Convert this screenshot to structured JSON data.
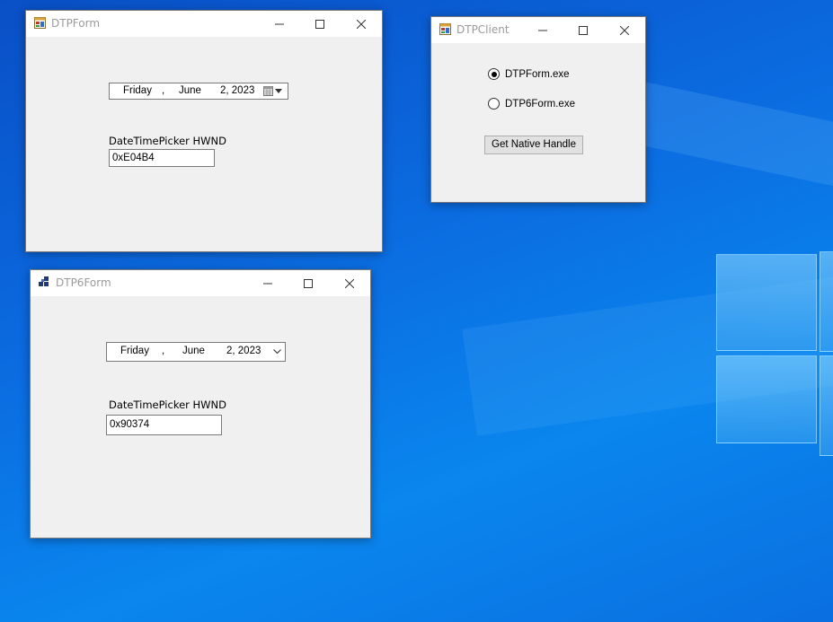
{
  "dtpform": {
    "title": "DTPForm",
    "dtp": {
      "day": "Friday",
      "comma": ",",
      "month": "June",
      "date": "2, 2023"
    },
    "hwnd_label": "DateTimePicker HWND",
    "hwnd_value": "0xE04B4"
  },
  "dtpclient": {
    "title": "DTPClient",
    "options": [
      {
        "label": "DTPForm.exe",
        "checked": true
      },
      {
        "label": "DTP6Form.exe",
        "checked": false
      }
    ],
    "button_label": "Get Native Handle"
  },
  "dtp6form": {
    "title": "DTP6Form",
    "dtp": {
      "day": "Friday",
      "comma": ",",
      "month": "June",
      "date": "2, 2023"
    },
    "hwnd_label": "DateTimePicker HWND",
    "hwnd_value": "0x90374"
  },
  "colors": {
    "desktop": "#0b6be0",
    "window_bg": "#f0f0f0",
    "title_text_inactive": "#9a9a9a"
  },
  "icons": [
    "form-icon",
    "minimize-icon",
    "maximize-icon",
    "close-icon",
    "calendar-dropdown-icon",
    "chevron-down-icon"
  ]
}
